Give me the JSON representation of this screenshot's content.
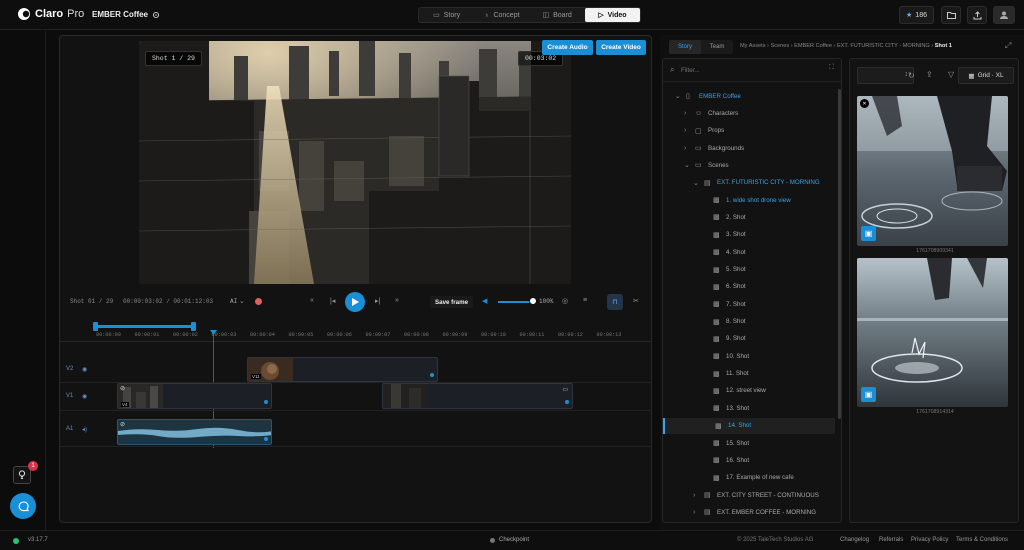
{
  "app": {
    "brand": "Claro",
    "brand_suffix": "Pro",
    "project": "EMBER Coffee"
  },
  "nav_tabs": [
    {
      "label": "Story",
      "icon": "book-icon"
    },
    {
      "label": "Concept",
      "icon": "lightbulb-icon"
    },
    {
      "label": "Board",
      "icon": "layers-icon"
    },
    {
      "label": "Video",
      "icon": "play-icon"
    }
  ],
  "header": {
    "credits": "186"
  },
  "preview": {
    "shot_label": "Shot 1 / 29",
    "timecode": "00:03:02",
    "create_audio": "Create Audio",
    "create_video": "Create Video"
  },
  "transport": {
    "shot_counter": "Shot 01 / 29",
    "time": "00:00:03:02 / 00:01:12:03",
    "ai_label": "AI",
    "save_frame": "Save frame",
    "volume": "100%",
    "volume_level": 0.9
  },
  "timeline": {
    "ticks": [
      "00:00:00",
      "00:00:01",
      "00:00:02",
      "00:00:03",
      "00:00:04",
      "00:00:05",
      "00:00:06",
      "00:00:07",
      "00:00:08",
      "00:00:09",
      "00:00:10",
      "00:00:11",
      "00:00:12",
      "00:00:13"
    ],
    "tracks": [
      "V2",
      "V1",
      "A1"
    ],
    "badges": {
      "v2": "V11",
      "v1": "V4"
    }
  },
  "right": {
    "tabs": [
      "Story",
      "Team"
    ],
    "breadcrumb": [
      "My Assets",
      "Scenes",
      "EMBER Coffee",
      "EXT. FUTURISTIC CITY - MORNING",
      "Shot 1"
    ],
    "filter_placeholder": "Filter...",
    "grid_label": "Grid · XL"
  },
  "tree": [
    {
      "label": "EMBER Coffee",
      "depth": 0,
      "type": "book",
      "blue": true,
      "chev": "down"
    },
    {
      "label": "Characters",
      "depth": 1,
      "type": "users",
      "chev": "right"
    },
    {
      "label": "Props",
      "depth": 1,
      "type": "box",
      "chev": "right"
    },
    {
      "label": "Backgrounds",
      "depth": 1,
      "type": "folder",
      "chev": "right"
    },
    {
      "label": "Scenes",
      "depth": 1,
      "type": "folder",
      "chev": "down"
    },
    {
      "label": "EXT. FUTURISTIC CITY - MORNING",
      "depth": 2,
      "type": "film",
      "blue": true,
      "chev": "down"
    },
    {
      "label": "1. wide shot drone view",
      "depth": 3,
      "type": "clap",
      "blue": true
    },
    {
      "label": "2. Shot",
      "depth": 3,
      "type": "clap"
    },
    {
      "label": "3. Shot",
      "depth": 3,
      "type": "clap"
    },
    {
      "label": "4. Shot",
      "depth": 3,
      "type": "clap"
    },
    {
      "label": "5. Shot",
      "depth": 3,
      "type": "clap"
    },
    {
      "label": "6. Shot",
      "depth": 3,
      "type": "clap"
    },
    {
      "label": "7. Shot",
      "depth": 3,
      "type": "clap"
    },
    {
      "label": "8. Shot",
      "depth": 3,
      "type": "clap"
    },
    {
      "label": "9. Shot",
      "depth": 3,
      "type": "clap"
    },
    {
      "label": "10. Shot",
      "depth": 3,
      "type": "clap"
    },
    {
      "label": "11. Shot",
      "depth": 3,
      "type": "clap"
    },
    {
      "label": "12. street view",
      "depth": 3,
      "type": "clap"
    },
    {
      "label": "13. Shot",
      "depth": 3,
      "type": "clap"
    },
    {
      "label": "14. Shot",
      "depth": 3,
      "type": "clap",
      "blue": true,
      "selected": true
    },
    {
      "label": "15. Shot",
      "depth": 3,
      "type": "clap"
    },
    {
      "label": "16. Shot",
      "depth": 3,
      "type": "clap"
    },
    {
      "label": "17. Example of new cafe",
      "depth": 3,
      "type": "clap"
    },
    {
      "label": "EXT. CITY STREET - CONTINUOUS",
      "depth": 2,
      "type": "film",
      "chev": "right"
    },
    {
      "label": "EXT. EMBER COFFEE - MORNING",
      "depth": 2,
      "type": "film",
      "chev": "right"
    },
    {
      "label": "INT. EMBER COFFEE - MORNING",
      "depth": 2,
      "type": "film",
      "chev": "right"
    }
  ],
  "gallery": [
    {
      "caption": "1761708909341"
    },
    {
      "caption": "1761708914314"
    }
  ],
  "footer": {
    "version": "v3.17.7",
    "checkpoint": "Checkpoint",
    "copyright": "© 2025 TaleTech Studios AG",
    "links": [
      "Changelog",
      "Referrals",
      "Privacy Policy",
      "Terms & Conditions"
    ]
  },
  "notif_count": "1",
  "colors": {
    "accent": "#1a8fd6",
    "selected_blue": "#3aa3e6",
    "status_green": "#2fbf71"
  }
}
